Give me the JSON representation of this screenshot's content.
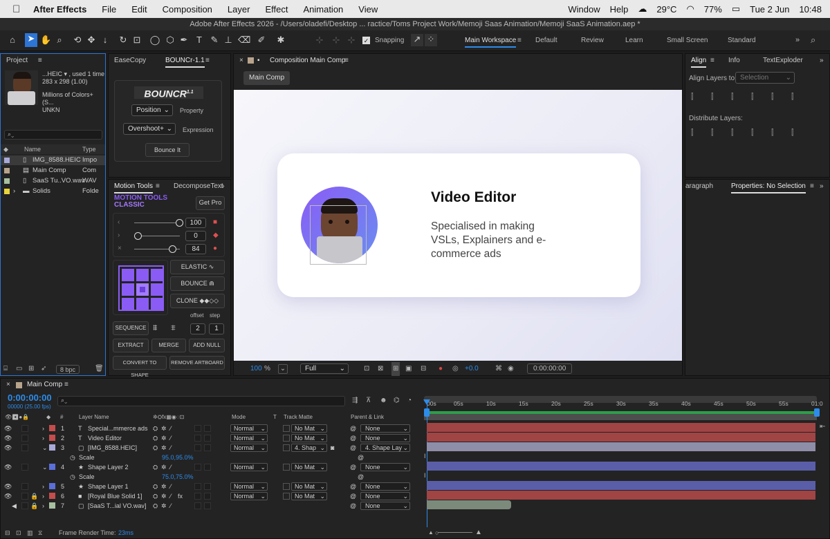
{
  "menubar": {
    "apple": "",
    "app": "After Effects",
    "items": [
      "File",
      "Edit",
      "Composition",
      "Layer",
      "Effect",
      "Animation",
      "View"
    ],
    "right": [
      "Window",
      "Help"
    ],
    "weather": "29°C",
    "battery": "77%",
    "date": "Tue 2 Jun",
    "time": "10:48"
  },
  "window_title": "Adobe After Effects 2026 - /Users/oladefi/Desktop ... ractice/Toms Project Work/Memoji Saas Animation/Memoji SaaS Animation.aep *",
  "toolbar": {
    "snapping": "Snapping",
    "workspaces": [
      "Main Workspace",
      "Default",
      "Review",
      "Learn",
      "Small Screen",
      "Standard"
    ]
  },
  "project": {
    "tab": "Project",
    "thumb_name": "...HEIC ▾ , used 1 time",
    "thumb_size": "283 x 298 (1.00)",
    "thumb_colors": "Millions of Colors+ (S...",
    "thumb_codec": "UNKN",
    "search_placeholder": "",
    "col_name": "Name",
    "col_type": "Type",
    "items": [
      {
        "name": "IMG_8588.HEIC",
        "type": "Impo",
        "color": "#a9a9d8"
      },
      {
        "name": "Main Comp",
        "type": "Com",
        "color": "#b8a48c"
      },
      {
        "name": "SaaS Tu..VO.wav",
        "type": "WAV",
        "color": "#a8c0a0"
      },
      {
        "name": "Solids",
        "type": "Folde",
        "color": "#e8d43c"
      }
    ],
    "bpc": "8 bpc"
  },
  "bouncr": {
    "tab1": "EaseCopy",
    "tab2": "BOUNCr-1.1",
    "logo": "BOUNCR",
    "logo_ver": "1.1",
    "property_value": "Position",
    "property_label": "Property",
    "expression_value": "Overshoot+",
    "expression_label": "Expression",
    "apply": "Bounce It"
  },
  "motiontools": {
    "tab1": "Motion Tools",
    "tab2": "DecomposeText",
    "logo1": "MOTION TOOLS",
    "logo2": "CLASSIC",
    "get_pro": "Get Pro",
    "sliders": [
      "100",
      "0",
      "84"
    ],
    "elastic": "ELASTIC",
    "bounce": "BOUNCE",
    "clone": "CLONE",
    "offset": "offset",
    "step": "step",
    "sequence": "SEQUENCE",
    "offset_val": "2",
    "step_val": "1",
    "extract": "EXTRACT",
    "merge": "MERGE",
    "add_null": "ADD NULL",
    "convert": "CONVERT TO SHAPE",
    "remove": "REMOVE ARTBOARD"
  },
  "composition": {
    "tab": "Composition Main Comp",
    "crumb": "Main Comp",
    "card_title": "Video Editor",
    "card_body": "Specialised in making VSLs, Explainers and e-commerce ads",
    "zoom": "100",
    "zoom_unit": "%",
    "quality": "Full",
    "exposure": "+0.0",
    "timecode": "0:00:00:00"
  },
  "align": {
    "tab": "Align",
    "tab2": "Info",
    "tab3": "TextExploder",
    "align_to_label": "Align Layers to:",
    "align_to_value": "Selection",
    "distribute_label": "Distribute Layers:",
    "tab4": "aragraph",
    "tab5": "Properties: No Selection"
  },
  "timeline": {
    "tab": "Main Comp",
    "timecode": "0:00:00:00",
    "frames": "00000 (25.00 fps)",
    "col_layer": "Layer Name",
    "col_mode": "Mode",
    "col_t": "T",
    "col_track": "Track Matte",
    "col_parent": "Parent & Link",
    "ruler": [
      "00s",
      "05s",
      "10s",
      "15s",
      "20s",
      "25s",
      "30s",
      "35s",
      "40s",
      "45s",
      "50s",
      "55s",
      "01:0"
    ],
    "layers": [
      {
        "n": "1",
        "icon": "T",
        "name": "Special...mmerce ads",
        "mode": "Normal",
        "matte": "No Mat",
        "parent": "None",
        "color": "#c44d4d",
        "bar": "#a04444"
      },
      {
        "n": "2",
        "icon": "T",
        "name": "Video Editor",
        "mode": "Normal",
        "matte": "No Mat",
        "parent": "None",
        "color": "#c44d4d",
        "bar": "#a04444"
      },
      {
        "n": "3",
        "icon": "▢",
        "name": "[IMG_8588.HEIC]",
        "mode": "Normal",
        "matte": "4. Shap",
        "parent": "4. Shape Lay",
        "color": "#a9a9d8",
        "bar": "#8e8ea8"
      },
      {
        "n": "",
        "icon": "",
        "name": "Scale",
        "value": "95.0,95.0%",
        "prop": true
      },
      {
        "n": "4",
        "icon": "★",
        "name": "Shape Layer 2",
        "mode": "Normal",
        "matte": "No Mat",
        "parent": "None",
        "color": "#5b6fd8",
        "bar": "#5a5ea8"
      },
      {
        "n": "",
        "icon": "",
        "name": "Scale",
        "value": "75.0,75.0%",
        "prop": true
      },
      {
        "n": "5",
        "icon": "★",
        "name": "Shape Layer 1",
        "mode": "Normal",
        "matte": "No Mat",
        "parent": "None",
        "color": "#5b6fd8",
        "bar": "#5a5ea8"
      },
      {
        "n": "6",
        "icon": "■",
        "name": "[Royal Blue Solid 1]",
        "mode": "Normal",
        "matte": "No Mat",
        "parent": "None",
        "color": "#c44d4d",
        "bar": "#a04444"
      },
      {
        "n": "7",
        "icon": "▢",
        "name": "[SaaS T...ial VO.wav]",
        "mode": "",
        "matte": "",
        "parent": "None",
        "color": "#a8c0a0",
        "bar": "#7c8a7c"
      }
    ],
    "render_label": "Frame Render Time:",
    "render_value": "23ms"
  }
}
